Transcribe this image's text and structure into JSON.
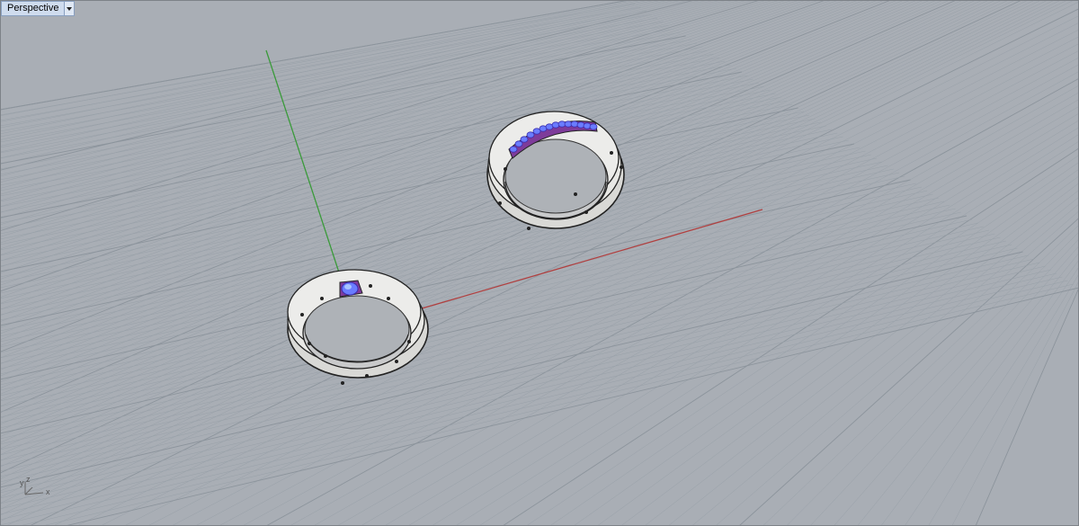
{
  "viewport": {
    "title": "Perspective",
    "dropdown_icon": "caret-down-icon",
    "background_color": "#a9aeb5"
  },
  "axes_widget": {
    "labels": {
      "y": "y",
      "z": "z",
      "x": "x"
    }
  },
  "scene": {
    "grid_color": "#98a0a8",
    "grid_major_color": "#8c949c",
    "x_axis_color": "#b04040",
    "y_axis_color": "#3a9a3a",
    "objects": [
      {
        "name": "ring-with-single-gem",
        "gems": 1,
        "gem_color": "#6a5cff"
      },
      {
        "name": "ring-with-channel-gems",
        "gems": 14,
        "gem_color": "#6a5cff"
      }
    ]
  }
}
